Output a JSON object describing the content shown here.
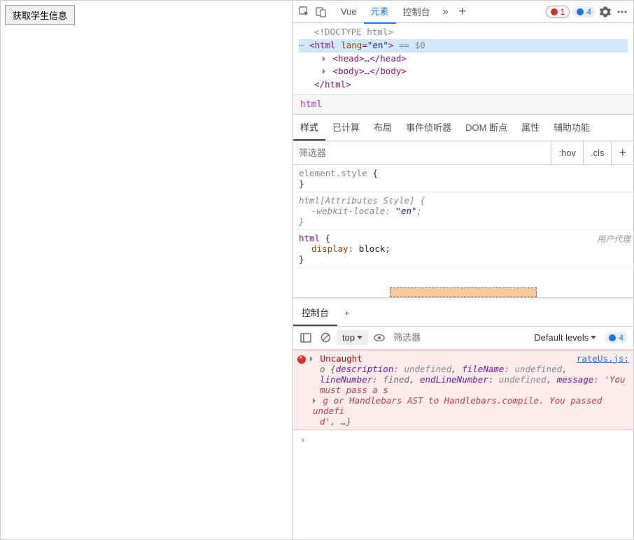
{
  "page": {
    "button_label": "获取学生信息"
  },
  "toolbar": {
    "tabs": [
      "Vue",
      "元素",
      "控制台"
    ],
    "active_tab": "元素",
    "errors": "1",
    "infos": "4"
  },
  "dom": {
    "doctype": "<!DOCTYPE html>",
    "html_open_pre": "<html ",
    "html_attr_name": "lang",
    "html_attr_val": "\"en\"",
    "html_open_post": ">",
    "eq_dollar": " == $0",
    "head": {
      "open": "<head>",
      "ellipsis": "…",
      "close": "</head>"
    },
    "body": {
      "open": "<body>",
      "ellipsis": "…",
      "close": "</body>"
    },
    "html_close": "</html>"
  },
  "breadcrumb": "html",
  "style_tabs": [
    "样式",
    "已计算",
    "布局",
    "事件侦听器",
    "DOM 断点",
    "属性",
    "辅助功能"
  ],
  "active_style_tab": "样式",
  "filter": {
    "placeholder": "筛选器",
    "hov": ":hov",
    "cls": ".cls"
  },
  "styles": {
    "rule1": {
      "selector": "element.style",
      "open": " {",
      "close": "}"
    },
    "rule2": {
      "selector": "html",
      "attr_sel": "[Attributes Style]",
      "open": " {",
      "prop": "-webkit-locale",
      "val": "\"en\"",
      "close": "}"
    },
    "rule3": {
      "selector": "html",
      "open": " {",
      "prop": "display",
      "val": "block",
      "close": "}",
      "ua": "用户代理"
    }
  },
  "console": {
    "tab": "控制台",
    "context": "top",
    "filter_placeholder": "筛选器",
    "levels": "Default levels",
    "info_count": "4",
    "error": {
      "title": "Uncaught",
      "link": "rateUs.js:",
      "detail": "o {description: undefined, fileName: undefined, lineNumber: fined, endLineNumber: undefined, message: 'You must pass a s g or Handlebars AST to Handlebars.compile. You passed undefi d', …}"
    }
  }
}
